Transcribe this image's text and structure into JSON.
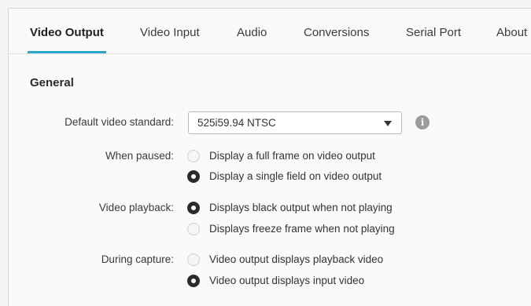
{
  "tabs": [
    {
      "label": "Video Output",
      "active": true
    },
    {
      "label": "Video Input",
      "active": false
    },
    {
      "label": "Audio",
      "active": false
    },
    {
      "label": "Conversions",
      "active": false
    },
    {
      "label": "Serial Port",
      "active": false
    },
    {
      "label": "About",
      "active": false
    }
  ],
  "section": {
    "title": "General"
  },
  "default_video_standard": {
    "label": "Default video standard:",
    "selected": "525i59.94 NTSC",
    "info_icon": "info-icon"
  },
  "when_paused": {
    "label": "When paused:",
    "options": [
      {
        "label": "Display a full frame on video output",
        "checked": false
      },
      {
        "label": "Display a single field on video output",
        "checked": true
      }
    ]
  },
  "video_playback": {
    "label": "Video playback:",
    "options": [
      {
        "label": "Displays black output when not playing",
        "checked": true
      },
      {
        "label": "Displays freeze frame when not playing",
        "checked": false
      }
    ]
  },
  "during_capture": {
    "label": "During capture:",
    "options": [
      {
        "label": "Video output displays playback video",
        "checked": false
      },
      {
        "label": "Video output displays input video",
        "checked": true
      }
    ]
  },
  "colors": {
    "accent": "#2aa7c9",
    "radio_checked": "#2b2b2b"
  }
}
